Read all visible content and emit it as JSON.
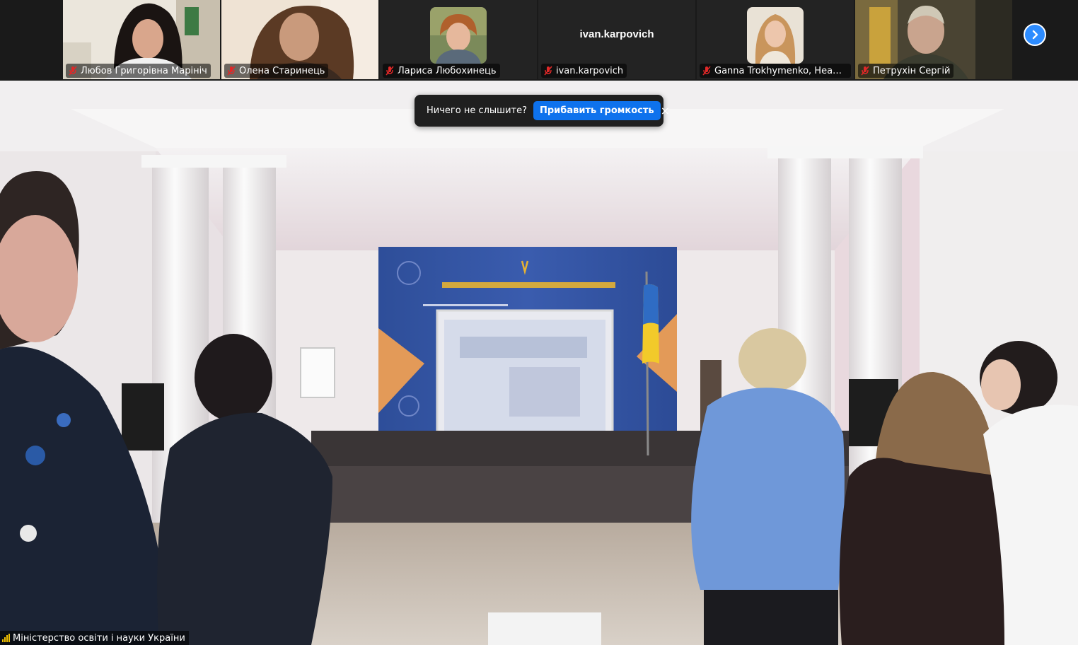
{
  "meeting": {
    "participants": [
      {
        "name": "Любов Григорівна Марініч",
        "muted": true,
        "has_video": true
      },
      {
        "name": "Олена Старинець",
        "muted": true,
        "has_video": true
      },
      {
        "name": "Лариса Любохинець",
        "muted": true,
        "has_video": false
      },
      {
        "name": "ivan.karpovich",
        "muted": true,
        "has_video": false,
        "display_text": "ivan.karpovich"
      },
      {
        "name": "Ganna Trokhymenko, Head of th...",
        "muted": true,
        "has_video": false
      },
      {
        "name": "Петрухін Сергій",
        "muted": true,
        "has_video": true
      }
    ],
    "next_page_icon": "chevron-right-icon",
    "audio_prompt": {
      "text": "Ничего не слышите?",
      "button_label": "Прибавить громкость",
      "close_icon": "×"
    },
    "active_speaker": {
      "name": "Міністерство освіти і науки України",
      "icon": "signal-bars-icon"
    }
  },
  "colors": {
    "accent": "#0e72ed",
    "toast_bg": "#1f1f1f",
    "strip_bg": "#1a1a1a",
    "mute_red": "#e02828"
  }
}
